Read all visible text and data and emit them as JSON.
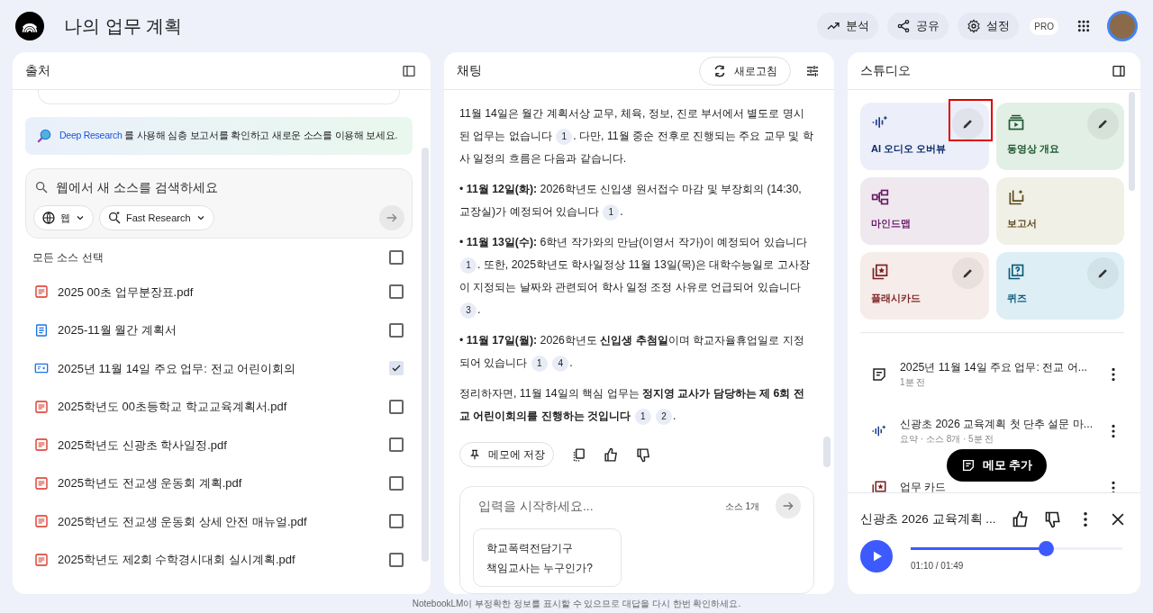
{
  "app": {
    "title": "나의 업무 계획",
    "actions": [
      {
        "kind": "analytics",
        "label": "분석"
      },
      {
        "kind": "share",
        "label": "공유"
      },
      {
        "kind": "settings",
        "label": "설정"
      }
    ],
    "plan_badge": "PRO"
  },
  "sources": {
    "title": "출처",
    "deep_research": {
      "link": "Deep Research",
      "text": " 를 사용해 심층 보고서를 확인하고 새로운 소스를 이용해 보세요."
    },
    "search": {
      "placeholder": "웹에서 새 소스를 검색하세요",
      "scope": "웹",
      "mode": "Fast Research"
    },
    "select_all": {
      "label": "모든 소스 선택",
      "checked": false
    },
    "items": [
      {
        "kind": "pdf",
        "name": "2025 00초 업무분장표.pdf",
        "checked": false
      },
      {
        "kind": "doc",
        "name": "2025-11월 월간 계획서",
        "checked": false
      },
      {
        "kind": "note",
        "name": "2025년 11월 14일 주요 업무: 전교 어린이회의",
        "checked": true
      },
      {
        "kind": "pdf",
        "name": "2025학년도 00초등학교 학교교육계획서.pdf",
        "checked": false
      },
      {
        "kind": "pdf",
        "name": "2025학년도 신광초 학사일정.pdf",
        "checked": false
      },
      {
        "kind": "pdf",
        "name": "2025학년도 전교생 운동회 계획.pdf",
        "checked": false
      },
      {
        "kind": "pdf",
        "name": "2025학년도 전교생 운동회 상세 안전 매뉴얼.pdf",
        "checked": false
      },
      {
        "kind": "pdf",
        "name": "2025학년도 제2회 수학경시대회 실시계획.pdf",
        "checked": false
      }
    ]
  },
  "chat": {
    "title": "채팅",
    "refresh": "새로고침",
    "paragraphs": [
      [
        {
          "text": "11월 14일은 월간 계획서상 교무, 체육, 정보, 진로 부서에서 별도로 명시된 업무는 없습니다"
        },
        {
          "cite": "1"
        },
        {
          "text": ". 다만, 11월 중순 전후로 진행되는 주요 교무 및 학사 일정의 흐름은 다음과 같습니다."
        }
      ],
      [
        {
          "text": "• **11월 12일(화):** 2026학년도 신입생 원서접수 마감 및 부장회의 (14:30, 교장실)가 예정되어 있습니다"
        },
        {
          "cite": "1"
        },
        {
          "text": "."
        }
      ],
      [
        {
          "text": "• **11월 13일(수):** 6학년 작가와의 만남(이영서 작가)이 예정되어 있습니다"
        },
        {
          "cite": "1"
        },
        {
          "text": ". 또한, 2025학년도 학사일정상 11월 13일(목)은 대학수능일로 고사장이 지정되는 날짜와 관련되어 학사 일정 조정 사유로 언급되어 있습니다"
        },
        {
          "cite": "3"
        },
        {
          "text": "."
        }
      ],
      [
        {
          "text": "• **11월 17일(월):** 2026학년도 **신입생 추첨일**이며 학교자율휴업일로 지정되어 있습니다"
        },
        {
          "cite": "1"
        },
        {
          "cite": "4"
        },
        {
          "text": "."
        }
      ],
      [
        {
          "text": "정리하자면, 11월 14일의 핵심 업무는 **정지영 교사가 담당하는 제 6회 전교 어린이회의를 진행하는 것입니다**"
        },
        {
          "cite": "1"
        },
        {
          "cite": "2"
        },
        {
          "text": "."
        }
      ]
    ],
    "save_note": "메모에 저장",
    "input": {
      "placeholder": "입력을 시작하세요...",
      "source_count": "소스 1개"
    },
    "suggestion": "학교폭력전담기구\n책임교사는 누구인가?"
  },
  "studio": {
    "title": "스튜디오",
    "tiles": [
      {
        "kind": "audio",
        "label": "AI 오디오 오버뷰",
        "color": "#eceff9",
        "editable": true,
        "highlighted": true
      },
      {
        "kind": "video",
        "label": "동영상 개요",
        "color": "#e2efe5",
        "editable": true,
        "highlighted": false
      },
      {
        "kind": "mindmap",
        "label": "마인드맵",
        "color": "#efe9ef",
        "editable": false,
        "highlighted": false
      },
      {
        "kind": "report",
        "label": "보고서",
        "color": "#f1f0e6",
        "editable": false,
        "highlighted": false
      },
      {
        "kind": "flashcard",
        "label": "플래시카드",
        "color": "#f6ece9",
        "editable": true,
        "highlighted": false
      },
      {
        "kind": "quiz",
        "label": "퀴즈",
        "color": "#ddeff5",
        "editable": true,
        "highlighted": false
      }
    ],
    "notes": [
      {
        "kind": "note",
        "title": "2025년 11월 14일 주요 업무: 전교 어...",
        "meta": "1분 전"
      },
      {
        "kind": "audio",
        "title": "신광초 2026 교육계획 첫 단추 설문 마...",
        "meta": "요약 · 소스 8개 · 5분 전"
      },
      {
        "kind": "flashcard",
        "title": "업무 카드"
      }
    ],
    "add_note": "메모 추가",
    "player": {
      "title": "신광초 2026 교육계획 ...",
      "level": 0.64,
      "time": "01:10 / 01:49"
    }
  },
  "footer": "NotebookLM이 부정확한 정보를 표시할 수 있으므로 대답을 다시 한번 확인하세요."
}
